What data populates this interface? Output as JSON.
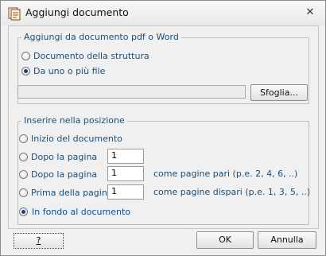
{
  "window": {
    "title": "Aggiungi documento"
  },
  "group_source": {
    "title": "Aggiungi da documento pdf o Word",
    "options": [
      "Documento della struttura",
      "Da uno o più file"
    ],
    "selected": "Da uno o più file",
    "file_path_value": "",
    "browse_label": "Sfoglia..."
  },
  "group_position": {
    "title": "Inserire nella posizione",
    "options": {
      "start": "Inizio del documento",
      "after_page": "Dopo la pagina",
      "after_page_even": "Dopo la pagina",
      "before_page": "Prima della pagina",
      "end": "In fondo al documento"
    },
    "selected": "In fondo al documento",
    "after_page_value": "1",
    "after_page_even_value": "1",
    "before_page_value": "1",
    "even_hint": "come pagine pari (p.e. 2, 4, 6, ..)",
    "odd_hint": "come pagine dispari (p.e. 1, 3, 5, ..)"
  },
  "footer": {
    "help_label": "?",
    "ok_label": "OK",
    "cancel_label": "Annulla"
  }
}
